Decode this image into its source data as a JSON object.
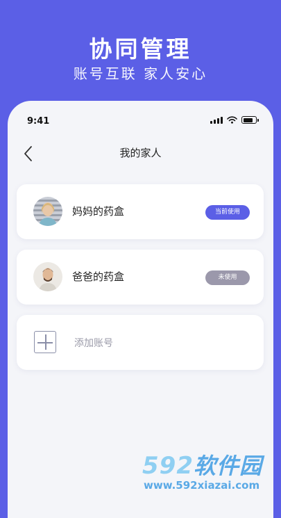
{
  "hero": {
    "title": "协同管理",
    "subtitle": "账号互联  家人安心"
  },
  "status_bar": {
    "time": "9:41"
  },
  "nav": {
    "title": "我的家人"
  },
  "family": [
    {
      "label": "妈妈的药盒",
      "status": "当前使用",
      "status_color": "#5b5fe6"
    },
    {
      "label": "爸爸的药盒",
      "status": "未使用",
      "status_color": "#9b98ab"
    }
  ],
  "add_account": {
    "label": "添加账号"
  },
  "watermark": {
    "logo_numbers": "592",
    "logo_text": "软件园",
    "url": "www.592xiazai.com"
  },
  "colors": {
    "brand": "#5b5fe6",
    "card_bg": "#ffffff",
    "page_bg": "#f4f5f9"
  }
}
